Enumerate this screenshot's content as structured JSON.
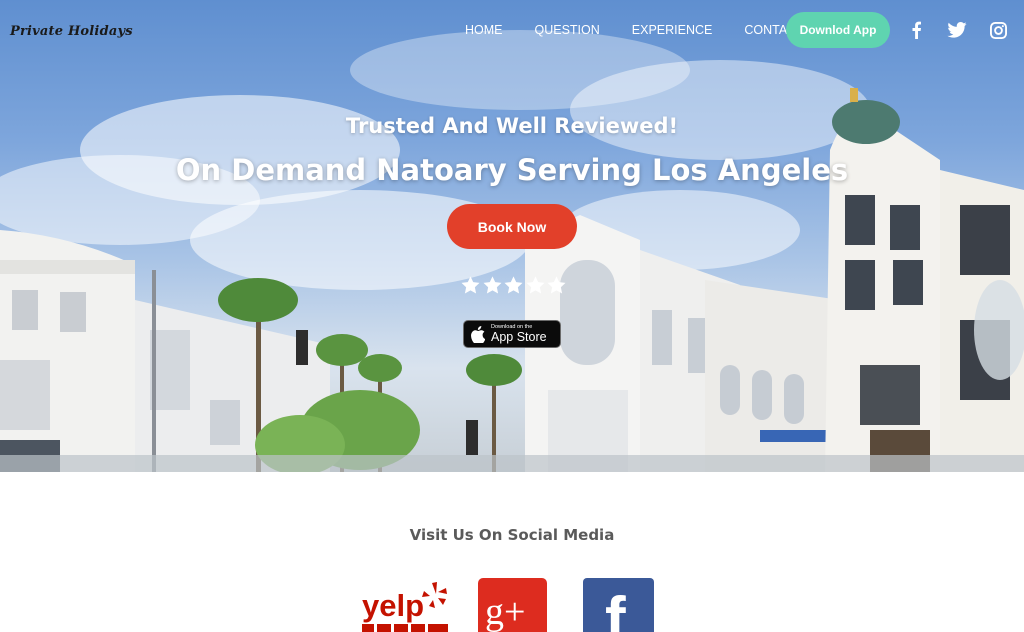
{
  "brand": {
    "name": "Private Holidays"
  },
  "nav": {
    "links": [
      "HOME",
      "QUESTION",
      "EXPERIENCE",
      "CONTACT"
    ],
    "download_label": "Downlod App",
    "social_icons": [
      "facebook-icon",
      "twitter-icon",
      "instagram-icon"
    ]
  },
  "hero": {
    "tagline": "Trusted And Well Reviewed!",
    "headline": "On Demand Natoary Serving Los Angeles",
    "book_label": "Book Now",
    "rating": 5,
    "rating_max": 5,
    "appstore_small": "Download on the",
    "appstore_big": "App Store"
  },
  "social": {
    "heading": "Visit Us On Social Media",
    "logos": [
      "yelp-logo",
      "google-plus-logo",
      "facebook-logo"
    ],
    "yelp_text": "yelp",
    "gplus_text": "g+",
    "fb_text": "f"
  },
  "colors": {
    "accent_green": "#5fd4b0",
    "book_red": "#e2402a",
    "gplus_red": "#dd2c1f",
    "facebook_blue": "#3b5998",
    "yelp_red": "#c41200"
  }
}
